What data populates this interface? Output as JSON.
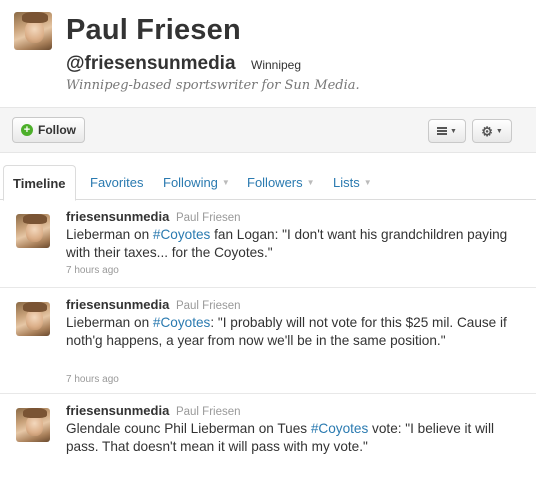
{
  "profile": {
    "name": "Paul Friesen",
    "handle": "@friesensunmedia",
    "location": "Winnipeg",
    "bio": "Winnipeg-based sportswriter for Sun Media."
  },
  "actions": {
    "follow_label": "Follow",
    "list_icon": "list-icon",
    "gear_icon": "gear-icon"
  },
  "tabs": [
    {
      "label": "Timeline",
      "active": true
    },
    {
      "label": "Favorites"
    },
    {
      "label": "Following",
      "has_dropdown": true
    },
    {
      "label": "Followers",
      "has_dropdown": true
    },
    {
      "label": "Lists",
      "has_dropdown": true
    }
  ],
  "tweets": [
    {
      "user": "friesensunmedia",
      "fullname": "Paul Friesen",
      "text_parts": [
        "Lieberman on ",
        "#Coyotes",
        " fan Logan: \"I don't want his grandchildren paying with their taxes... for the Coyotes.\""
      ],
      "time": "7 hours ago"
    },
    {
      "user": "friesensunmedia",
      "fullname": "Paul Friesen",
      "text_parts": [
        "Lieberman on ",
        "#Coyotes",
        ": \"I probably will not vote for this $25 mil. Cause if noth'g happens, a year from now we'll be in the same position.\""
      ],
      "time": "7 hours ago"
    },
    {
      "user": "friesensunmedia",
      "fullname": "Paul Friesen",
      "text_parts": [
        "Glendale counc Phil Lieberman on Tues ",
        "#Coyotes",
        " vote: \"I believe it will pass. That doesn't mean it will pass with my vote.\""
      ],
      "time": ""
    }
  ],
  "colors": {
    "link": "#2a7ab0",
    "follow_icon": "#4caf2a",
    "muted": "#999999"
  }
}
